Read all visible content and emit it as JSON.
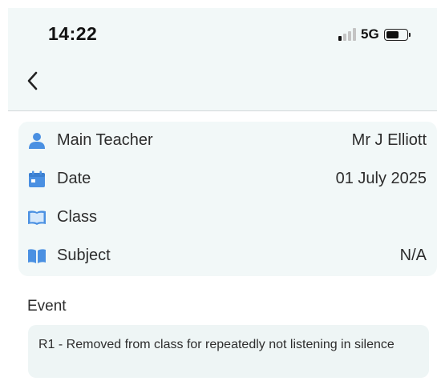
{
  "status_bar": {
    "time": "14:22",
    "network": "5G",
    "signal_bars_active": 1,
    "signal_bars_total": 4,
    "battery_level": 0.65
  },
  "nav": {
    "back_icon": "chevron-left-icon"
  },
  "details": {
    "rows": [
      {
        "icon": "person-icon",
        "label": "Main Teacher",
        "value": "Mr J Elliott"
      },
      {
        "icon": "calendar-icon",
        "label": "Date",
        "value": "01 July 2025"
      },
      {
        "icon": "book-icon",
        "label": "Class",
        "value": ""
      },
      {
        "icon": "open-book-icon",
        "label": "Subject",
        "value": "N/A"
      }
    ]
  },
  "event": {
    "title": "Event",
    "text": "R1 - Removed from class for repeatedly not listening in silence"
  },
  "colors": {
    "header_bg": "#f2f8f8",
    "card_bg": "#f2f8f8",
    "icon_blue": "#4a90e2",
    "text": "#2d2d2d"
  }
}
